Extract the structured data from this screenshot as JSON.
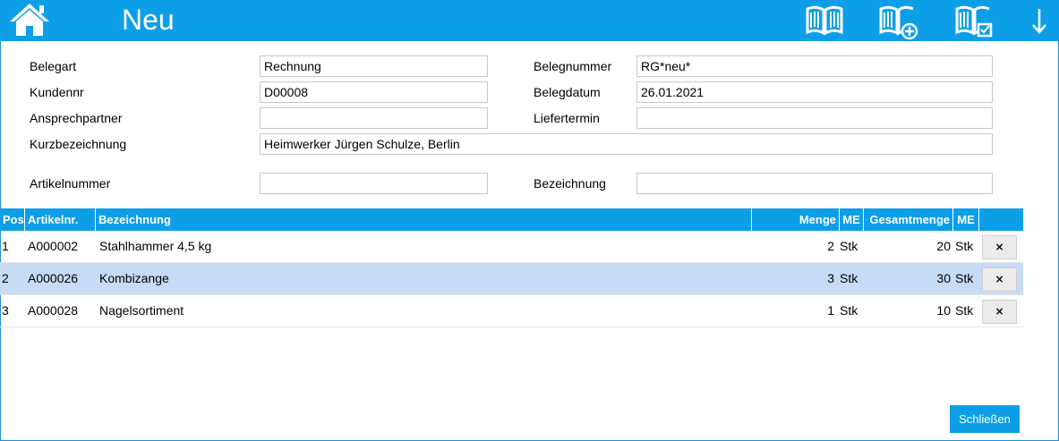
{
  "header": {
    "title": "Neu",
    "accent_color": "#0d9ee8",
    "icons": [
      "home-icon",
      "book-icon",
      "book-add-icon",
      "book-check-icon",
      "arrow-down-icon"
    ]
  },
  "form": {
    "belegart": {
      "label": "Belegart",
      "value": "Rechnung"
    },
    "belegnummer": {
      "label": "Belegnummer",
      "value": "RG*neu*"
    },
    "kundennr": {
      "label": "Kundennr",
      "value": "D00008"
    },
    "belegdatum": {
      "label": "Belegdatum",
      "value": "26.01.2021"
    },
    "ansprechpartner": {
      "label": "Ansprechpartner",
      "value": ""
    },
    "liefertermin": {
      "label": "Liefertermin",
      "value": ""
    },
    "kurzbezeichnung": {
      "label": "Kurzbezeichnung",
      "value": "Heimwerker Jürgen Schulze, Berlin"
    },
    "artikelnummer": {
      "label": "Artikelnummer",
      "value": ""
    },
    "bezeichnung": {
      "label": "Bezeichnung",
      "value": ""
    }
  },
  "table": {
    "columns": {
      "pos": "Pos",
      "artikelnr": "Artikelnr.",
      "bezeichnung": "Bezeichnung",
      "menge": "Menge",
      "me": "ME",
      "gesamtmenge": "Gesamtmenge",
      "me2": "ME"
    },
    "rows": [
      {
        "pos": "1",
        "artikelnr": "A000002",
        "bezeichnung": "Stahlhammer 4,5 kg",
        "menge": "2",
        "me": "Stk",
        "gesamtmenge": "20",
        "me2": "Stk",
        "delete": "×",
        "selected": false
      },
      {
        "pos": "2",
        "artikelnr": "A000026",
        "bezeichnung": "Kombizange",
        "menge": "3",
        "me": "Stk",
        "gesamtmenge": "30",
        "me2": "Stk",
        "delete": "×",
        "selected": true
      },
      {
        "pos": "3",
        "artikelnr": "A000028",
        "bezeichnung": "Nagelsortiment",
        "menge": "1",
        "me": "Stk",
        "gesamtmenge": "10",
        "me2": "Stk",
        "delete": "×",
        "selected": false
      }
    ]
  },
  "footer": {
    "close_label": "Schließen"
  }
}
